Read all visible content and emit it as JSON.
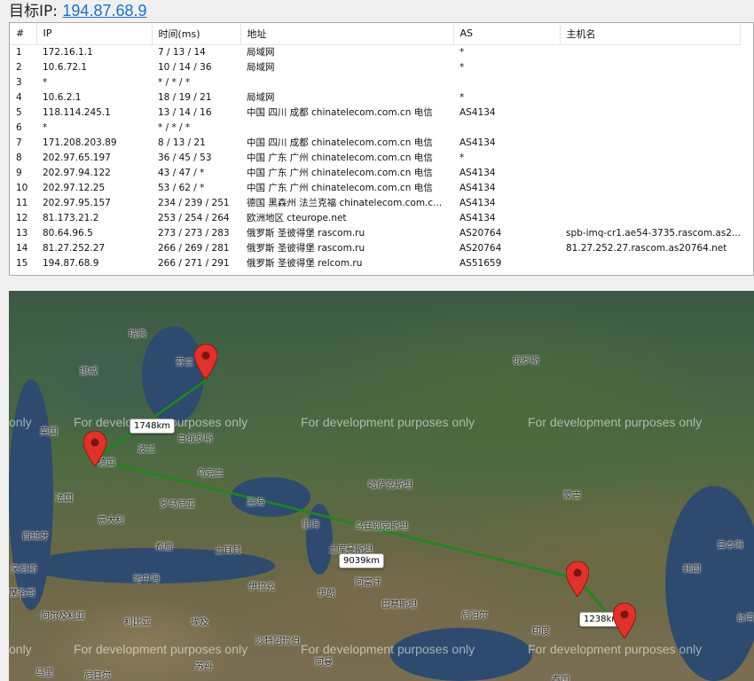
{
  "target": {
    "label": "目标IP:",
    "ip": "194.87.68.9"
  },
  "table": {
    "headers": [
      "#",
      "IP",
      "时间(ms)",
      "地址",
      "AS",
      "主机名"
    ],
    "rows": [
      [
        "1",
        "172.16.1.1",
        "7 / 13 / 14",
        "局域网",
        "*",
        ""
      ],
      [
        "2",
        "10.6.72.1",
        "10 / 14 / 36",
        "局域网",
        "*",
        ""
      ],
      [
        "3",
        "*",
        "* / * / *",
        "",
        "",
        ""
      ],
      [
        "4",
        "10.6.2.1",
        "18 / 19 / 21",
        "局域网",
        "*",
        ""
      ],
      [
        "5",
        "118.114.245.1",
        "13 / 14 / 16",
        "中国 四川 成都 chinatelecom.com.cn 电信",
        "AS4134",
        ""
      ],
      [
        "6",
        "*",
        "* / * / *",
        "",
        "",
        ""
      ],
      [
        "7",
        "171.208.203.89",
        "8 / 13 / 21",
        "中国 四川 成都 chinatelecom.com.cn 电信",
        "AS4134",
        ""
      ],
      [
        "8",
        "202.97.65.197",
        "36 / 45 / 53",
        "中国 广东 广州 chinatelecom.com.cn 电信",
        "*",
        ""
      ],
      [
        "9",
        "202.97.94.122",
        "43 / 47 / *",
        "中国 广东 广州 chinatelecom.com.cn 电信",
        "AS4134",
        ""
      ],
      [
        "10",
        "202.97.12.25",
        "53 / 62 / *",
        "中国 广东 广州 chinatelecom.com.cn 电信",
        "AS4134",
        ""
      ],
      [
        "11",
        "202.97.95.157",
        "234 / 239 / 251",
        "德国 黑森州 法兰克福 chinatelecom.com.c...",
        "AS4134",
        ""
      ],
      [
        "12",
        "81.173.21.2",
        "253 / 254 / 264",
        "欧洲地区 cteurope.net",
        "AS4134",
        ""
      ],
      [
        "13",
        "80.64.96.5",
        "273 / 273 / 283",
        "俄罗斯 圣彼得堡 rascom.ru",
        "AS20764",
        "spb-imq-cr1.ae54-3735.rascom.as2..."
      ],
      [
        "14",
        "81.27.252.27",
        "266 / 269 / 281",
        "俄罗斯 圣彼得堡 rascom.ru",
        "AS20764",
        "81.27.252.27.rascom.as20764.net"
      ],
      [
        "15",
        "194.87.68.9",
        "266 / 271 / 291",
        "俄罗斯 圣彼得堡 relcom.ru",
        "AS51659",
        ""
      ]
    ]
  },
  "map": {
    "watermark": "For development purposes only",
    "watermark_fragment": "only",
    "distances": [
      "1748km",
      "9039km",
      "1238km"
    ],
    "labels": [
      "瑞典",
      "芬兰",
      "挪威",
      "俄罗斯",
      "英国",
      "白俄罗斯",
      "波兰",
      "乌克兰",
      "德国",
      "法国",
      "罗马尼亚",
      "意大利",
      "西班牙",
      "希腊",
      "土耳其",
      "哈萨克斯坦",
      "乌兹别克斯坦",
      "土库曼斯坦",
      "蒙古",
      "伊朗",
      "伊拉克",
      "阿富汗",
      "巴基斯坦",
      "尼泊尔",
      "突尼斯",
      "摩洛哥",
      "阿尔及利亚",
      "利比亚",
      "埃及",
      "沙特阿拉伯",
      "马里",
      "尼日尔",
      "日本海",
      "韩国",
      "泰国",
      "地中海",
      "黑海",
      "里海",
      "印度",
      "苏丹",
      "阿曼",
      "台湾"
    ],
    "route_color": "#1a8a1a",
    "pin_color": "#e0312a"
  }
}
